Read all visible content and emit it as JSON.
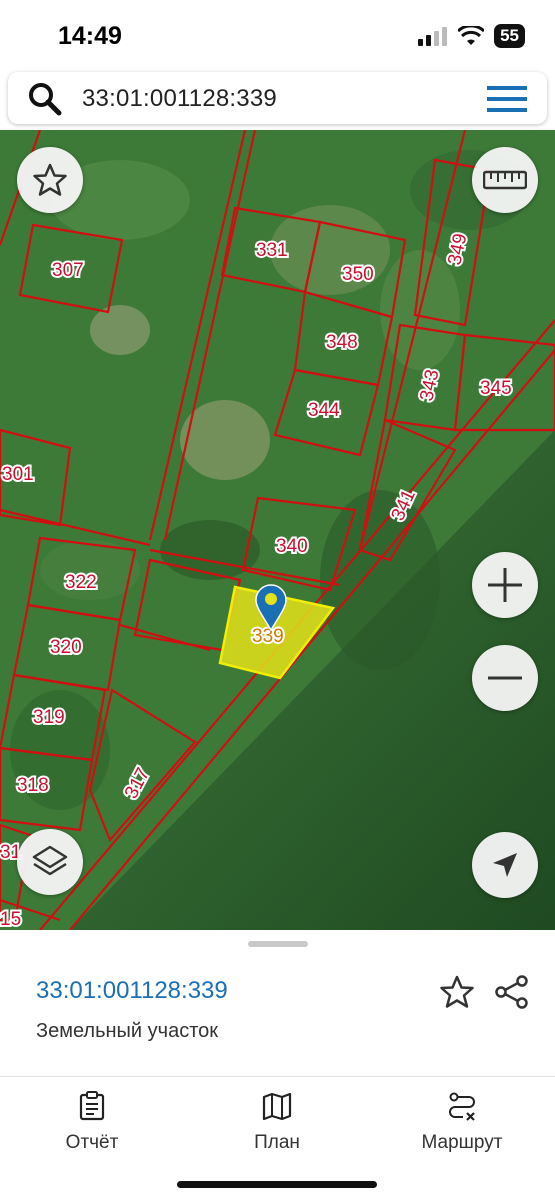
{
  "status": {
    "time": "14:49",
    "battery": "55"
  },
  "search": {
    "query": "33:01:001128:339"
  },
  "map": {
    "parcels": [
      "307",
      "331",
      "350",
      "349",
      "348",
      "343",
      "345",
      "344",
      "301",
      "341",
      "340",
      "322",
      "320",
      "339",
      "319",
      "318",
      "317",
      "31",
      "15"
    ]
  },
  "sheet": {
    "cadastral_number": "33:01:001128:339",
    "type": "Земельный участок"
  },
  "tabs": [
    {
      "label": "Отчёт"
    },
    {
      "label": "План"
    },
    {
      "label": "Маршрут"
    }
  ]
}
